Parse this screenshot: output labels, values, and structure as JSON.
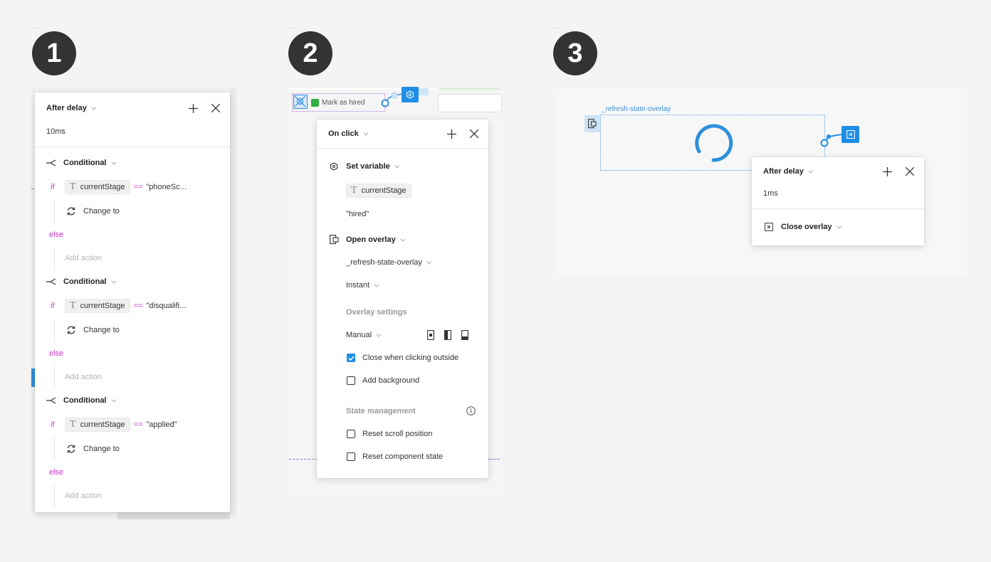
{
  "steps": [
    {
      "number": "1",
      "dots": "..."
    },
    {
      "number": "2",
      "dots": "..."
    },
    {
      "number": "3",
      "dots": "..."
    }
  ],
  "panel1": {
    "title": "After delay",
    "delay": "10ms",
    "conditionals": [
      {
        "label": "Conditional",
        "if": "if",
        "variable": "currentStage",
        "operator": "==",
        "value": "\"phoneSc...",
        "action": "Change to",
        "else": "else",
        "else_action": "Add action"
      },
      {
        "label": "Conditional",
        "if": "if",
        "variable": "currentStage",
        "operator": "==",
        "value": "\"disqualifi...",
        "action": "Change to",
        "else": "else",
        "else_action": "Add action"
      },
      {
        "label": "Conditional",
        "if": "if",
        "variable": "currentStage",
        "operator": "==",
        "value": "\"applied\"",
        "action": "Change to",
        "else": "else",
        "else_action": "Add action"
      }
    ]
  },
  "panel2": {
    "canvas_button_label": "Mark as hired",
    "title": "On click",
    "set_variable": {
      "label": "Set variable",
      "variable": "currentStage",
      "value": "\"hired\""
    },
    "open_overlay": {
      "label": "Open overlay",
      "destination": "_refresh-state-overlay",
      "animation": "Instant"
    },
    "overlay_settings": {
      "label": "Overlay settings",
      "position": "Manual",
      "close_when_clicking_outside": {
        "label": "Close when clicking outside",
        "checked": true
      },
      "add_background": {
        "label": "Add background",
        "checked": false
      }
    },
    "state_management": {
      "label": "State management",
      "reset_scroll_position": {
        "label": "Reset scroll position",
        "checked": false
      },
      "reset_component_state": {
        "label": "Reset component state",
        "checked": false
      }
    }
  },
  "panel3": {
    "frame_label": "_refresh-state-overlay",
    "title": "After delay",
    "delay": "1ms",
    "action": "Close overlay"
  },
  "colors": {
    "accent": "#1e8ee6",
    "pink": "#c737c9",
    "step_badge": "#333333"
  }
}
